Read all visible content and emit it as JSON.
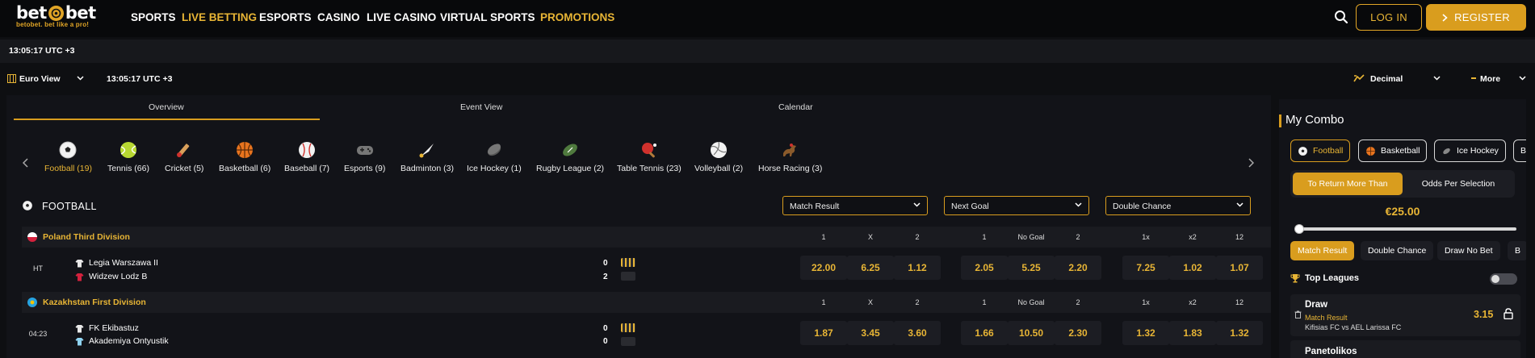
{
  "brand": {
    "logo_left": "bet",
    "logo_right": "bet",
    "tagline": "betobet. bet like a pro!"
  },
  "nav": [
    "SPORTS",
    "LIVE BETTING",
    "ESPORTS",
    "CASINO",
    "LIVE CASINO",
    "VIRTUAL SPORTS",
    "PROMOTIONS"
  ],
  "header": {
    "login": "LOG IN",
    "register": "REGISTER"
  },
  "clock": "13:05:17 UTC +3",
  "subbar": {
    "view": "Euro View",
    "clock": "13:05:17 UTC +3",
    "odds_format": "Decimal",
    "more": "More"
  },
  "tabs": [
    "Overview",
    "Event View",
    "Calendar"
  ],
  "sports": [
    "Football (19)",
    "Tennis (66)",
    "Cricket (5)",
    "Basketball (6)",
    "Baseball (7)",
    "Esports (9)",
    "Badminton (3)",
    "Ice Hockey (1)",
    "Rugby League (2)",
    "Table Tennis (23)",
    "Volleyball (2)",
    "Horse Racing (3)"
  ],
  "section": {
    "title": "FOOTBALL",
    "markets": [
      "Match Result",
      "Next Goal",
      "Double Chance"
    ]
  },
  "market_headers": [
    "1",
    "X",
    "2",
    "1",
    "No Goal",
    "2",
    "1x",
    "x2",
    "12"
  ],
  "leagues": [
    {
      "name": "Poland Third Division",
      "match": {
        "time": "HT",
        "home": "Legia Warszawa II",
        "away": "Widzew Lodz B",
        "home_score": "0",
        "away_score": "2",
        "odds": [
          "22.00",
          "6.25",
          "1.12",
          "2.05",
          "5.25",
          "2.20",
          "7.25",
          "1.02",
          "1.07"
        ]
      }
    },
    {
      "name": "Kazakhstan First Division",
      "match": {
        "time": "04:23",
        "home": "FK Ekibastuz",
        "away": "Akademiya Ontyustik",
        "home_score": "0",
        "away_score": "0",
        "odds": [
          "1.87",
          "3.45",
          "3.60",
          "1.66",
          "10.50",
          "2.30",
          "1.32",
          "1.83",
          "1.32"
        ]
      }
    }
  ],
  "combo": {
    "title": "My Combo",
    "chips": [
      "Football",
      "Basketball",
      "Ice Hockey",
      "B"
    ],
    "mode_on": "To Return More Than",
    "mode_off": "Odds Per Selection",
    "amount": "€25.00",
    "slider_level": 0,
    "markets": [
      "Match Result",
      "Double Chance",
      "Draw No Bet",
      "B"
    ],
    "top_leagues": "Top Leagues",
    "bets": [
      {
        "pick": "Draw",
        "market": "Match Result",
        "event": "Kifisias FC vs AEL Larissa FC",
        "odd": "3.15"
      },
      {
        "pick": "Panetolikos"
      }
    ]
  },
  "colors": {
    "accent": "#d99d1e",
    "odds_text": "#e8b535",
    "background": "#0e0f12",
    "panel": "#121318"
  }
}
